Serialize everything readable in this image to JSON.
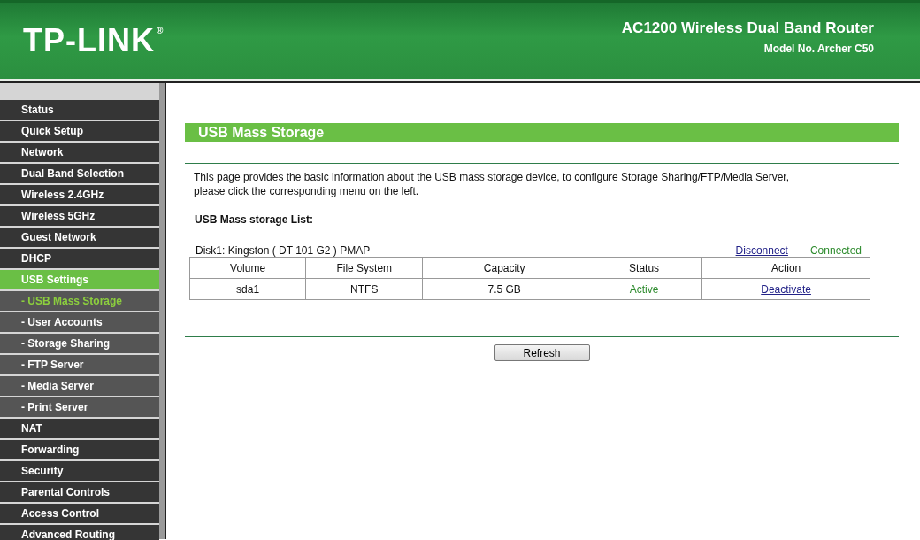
{
  "header": {
    "logo": "TP-LINK",
    "registered": "®",
    "product": "AC1200 Wireless Dual Band Router",
    "model": "Model No. Archer C50"
  },
  "menu": [
    {
      "label": "Status",
      "kind": "main",
      "selected": false
    },
    {
      "label": "Quick Setup",
      "kind": "main",
      "selected": false
    },
    {
      "label": "Network",
      "kind": "main",
      "selected": false
    },
    {
      "label": "Dual Band Selection",
      "kind": "main",
      "selected": false
    },
    {
      "label": "Wireless 2.4GHz",
      "kind": "main",
      "selected": false
    },
    {
      "label": "Wireless 5GHz",
      "kind": "main",
      "selected": false
    },
    {
      "label": "Guest Network",
      "kind": "main",
      "selected": false
    },
    {
      "label": "DHCP",
      "kind": "main",
      "selected": false
    },
    {
      "label": "USB Settings",
      "kind": "main",
      "selected": true
    },
    {
      "label": "- USB Mass Storage",
      "kind": "sub",
      "selected": true
    },
    {
      "label": "- User Accounts",
      "kind": "sub",
      "selected": false
    },
    {
      "label": "- Storage Sharing",
      "kind": "sub",
      "selected": false
    },
    {
      "label": "- FTP Server",
      "kind": "sub",
      "selected": false
    },
    {
      "label": "- Media Server",
      "kind": "sub",
      "selected": false
    },
    {
      "label": "- Print Server",
      "kind": "sub",
      "selected": false
    },
    {
      "label": "NAT",
      "kind": "main",
      "selected": false
    },
    {
      "label": "Forwarding",
      "kind": "main",
      "selected": false
    },
    {
      "label": "Security",
      "kind": "main",
      "selected": false
    },
    {
      "label": "Parental Controls",
      "kind": "main",
      "selected": false
    },
    {
      "label": "Access Control",
      "kind": "main",
      "selected": false
    },
    {
      "label": "Advanced Routing",
      "kind": "main",
      "selected": false
    }
  ],
  "page": {
    "title": "USB Mass Storage",
    "description": "This page provides the basic information about the USB mass storage device, to configure Storage Sharing/FTP/Media Server, please click the corresponding menu on the left.",
    "list_title": "USB Mass storage List:",
    "disk": {
      "name": "Disk1: Kingston ( DT 101 G2 ) PMAP",
      "link": "Disconnect",
      "state": "Connected"
    },
    "table": {
      "columns": [
        "Volume",
        "File System",
        "Capacity",
        "Status",
        "Action"
      ],
      "rows": [
        {
          "volume": "sda1",
          "file_system": "NTFS",
          "capacity": "7.5 GB",
          "status": "Active",
          "action": "Deactivate"
        }
      ]
    },
    "button": "Refresh"
  }
}
